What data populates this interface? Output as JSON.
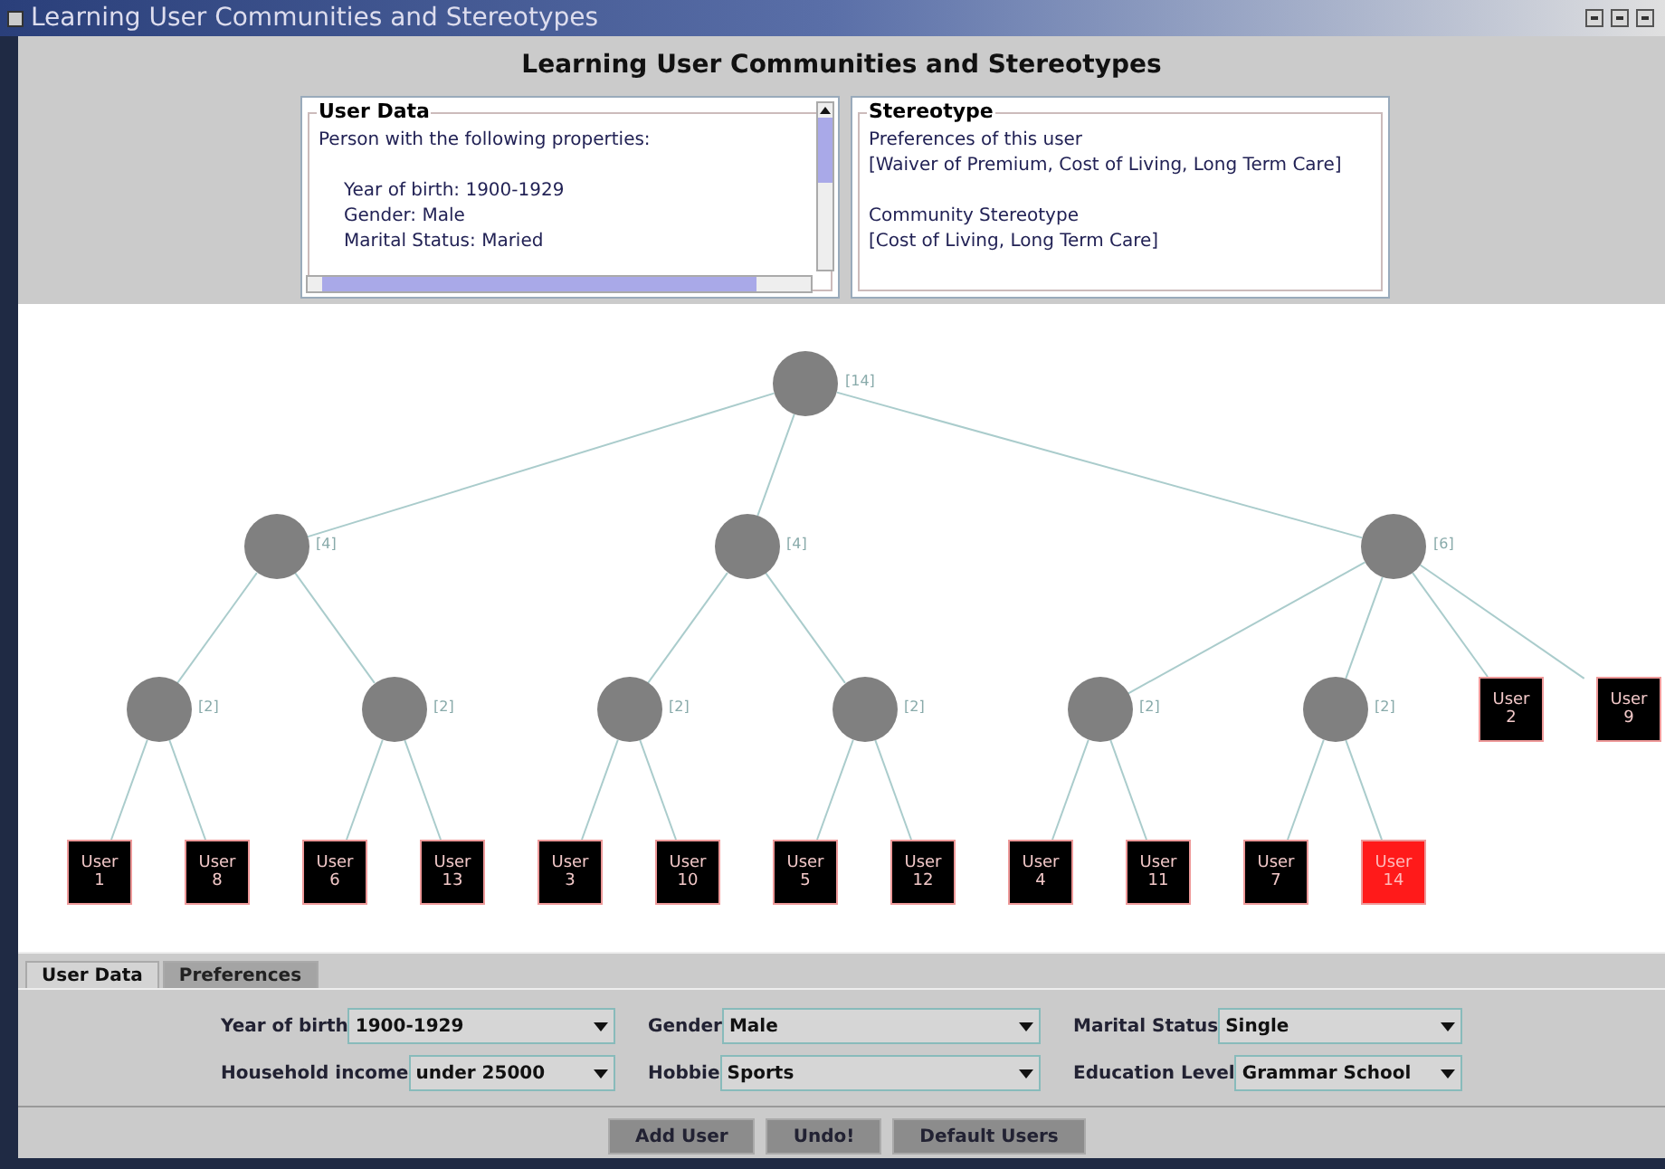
{
  "window": {
    "title": "Learning User Communities and Stereotypes"
  },
  "header": "Learning User Communities and Stereotypes",
  "user_data": {
    "title": "User Data",
    "intro": "Person with the following properties:",
    "properties": [
      "Year of birth: 1900-1929",
      "Gender: Male",
      "Marital Status: Maried"
    ]
  },
  "stereotype": {
    "title": "Stereotype",
    "sections": [
      {
        "heading": "Preferences of this user",
        "value": "[Waiver of Premium, Cost of Living, Long Term Care]"
      },
      {
        "heading": "Community Stereotype",
        "value": "[Cost of Living, Long Term Care]"
      }
    ]
  },
  "tree": {
    "count": "[14]",
    "children": [
      {
        "count": "[4]",
        "children": [
          {
            "count": "[2]",
            "children": [
              {
                "user": "User 1",
                "selected": false
              },
              {
                "user": "User 8",
                "selected": false
              }
            ]
          },
          {
            "count": "[2]",
            "children": [
              {
                "user": "User 6",
                "selected": false
              },
              {
                "user": "User 13",
                "selected": false
              }
            ]
          }
        ]
      },
      {
        "count": "[4]",
        "children": [
          {
            "count": "[2]",
            "children": [
              {
                "user": "User 3",
                "selected": false
              },
              {
                "user": "User 10",
                "selected": false
              }
            ]
          },
          {
            "count": "[2]",
            "children": [
              {
                "user": "User 5",
                "selected": false
              },
              {
                "user": "User 12",
                "selected": false
              }
            ]
          }
        ]
      },
      {
        "count": "[6]",
        "children": [
          {
            "count": "[2]",
            "children": [
              {
                "user": "User 4",
                "selected": false
              },
              {
                "user": "User 11",
                "selected": false
              }
            ]
          },
          {
            "count": "[2]",
            "children": [
              {
                "user": "User 7",
                "selected": false
              },
              {
                "user": "User 14",
                "selected": true
              }
            ]
          },
          {
            "user": "User 2",
            "selected": false
          },
          {
            "user": "User 9",
            "selected": false
          }
        ]
      }
    ]
  },
  "tabs": [
    {
      "label": "User Data",
      "selected": true
    },
    {
      "label": "Preferences",
      "selected": false
    }
  ],
  "fields": [
    {
      "label": "Year of birth",
      "value": "1900-1929"
    },
    {
      "label": "Gender",
      "value": "Male"
    },
    {
      "label": "Marital Status",
      "value": "Single"
    },
    {
      "label": "Household income",
      "value": "under 25000"
    },
    {
      "label": "Hobbie",
      "value": "Sports"
    },
    {
      "label": "Education Level",
      "value": "Grammar School"
    }
  ],
  "buttons": [
    "Add User",
    "Undo!",
    "Default Users"
  ]
}
